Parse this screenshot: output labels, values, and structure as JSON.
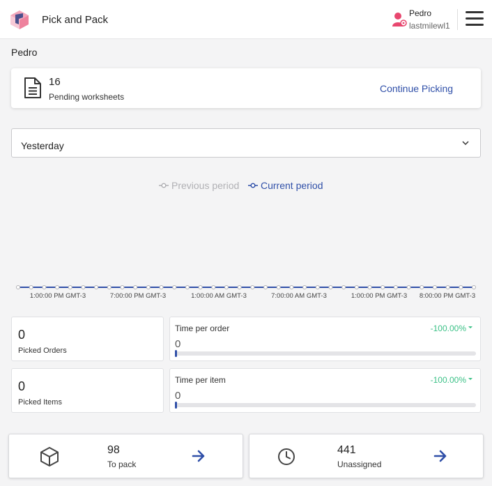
{
  "header": {
    "app_title": "Pick and Pack",
    "user_name": "Pedro",
    "user_subtitle": "lastmilewl1"
  },
  "page": {
    "section_name": "Pedro"
  },
  "pending": {
    "count": "16",
    "label": "Pending worksheets",
    "action_label": "Continue Picking"
  },
  "period_select": {
    "value": "Yesterday"
  },
  "legend": {
    "previous": "Previous period",
    "current": "Current period"
  },
  "chart_data": {
    "type": "line",
    "x_tick_labels": [
      "1:00:00 PM GMT-3",
      "7:00:00 PM GMT-3",
      "1:00:00 AM GMT-3",
      "7:00:00 AM GMT-3",
      "1:00:00 PM GMT-3",
      "8:00:00 PM GMT-3"
    ],
    "series": [
      {
        "name": "Previous period",
        "values": [
          0,
          0,
          0,
          0,
          0,
          0,
          0,
          0,
          0,
          0,
          0,
          0,
          0,
          0,
          0,
          0,
          0,
          0,
          0,
          0,
          0,
          0,
          0,
          0,
          0,
          0,
          0,
          0,
          0,
          0,
          0,
          0,
          0,
          0,
          0,
          0
        ]
      },
      {
        "name": "Current period",
        "values": [
          0,
          0,
          0,
          0,
          0,
          0,
          0,
          0,
          0,
          0,
          0,
          0,
          0,
          0,
          0,
          0,
          0,
          0,
          0,
          0,
          0,
          0,
          0,
          0,
          0,
          0,
          0,
          0,
          0,
          0,
          0,
          0,
          0,
          0,
          0,
          0
        ]
      }
    ],
    "colors": {
      "previous": "#b0b0b4",
      "current": "#2f4fa8"
    }
  },
  "stats": {
    "picked_orders": {
      "value": "0",
      "label": "Picked Orders"
    },
    "picked_items": {
      "value": "0",
      "label": "Picked Items"
    }
  },
  "metrics": {
    "time_per_order": {
      "title": "Time per order",
      "change": "-100.00%",
      "value": "0",
      "progress": 0
    },
    "time_per_item": {
      "title": "Time per item",
      "change": "-100.00%",
      "value": "0",
      "progress": 0
    }
  },
  "bottom": {
    "to_pack": {
      "value": "98",
      "label": "To pack",
      "icon": "box-icon"
    },
    "unassigned": {
      "value": "441",
      "label": "Unassigned",
      "icon": "clock-icon"
    }
  },
  "colors": {
    "accent": "#2f4fa8",
    "positive": "#3cc187",
    "brand": "#e8476f"
  }
}
